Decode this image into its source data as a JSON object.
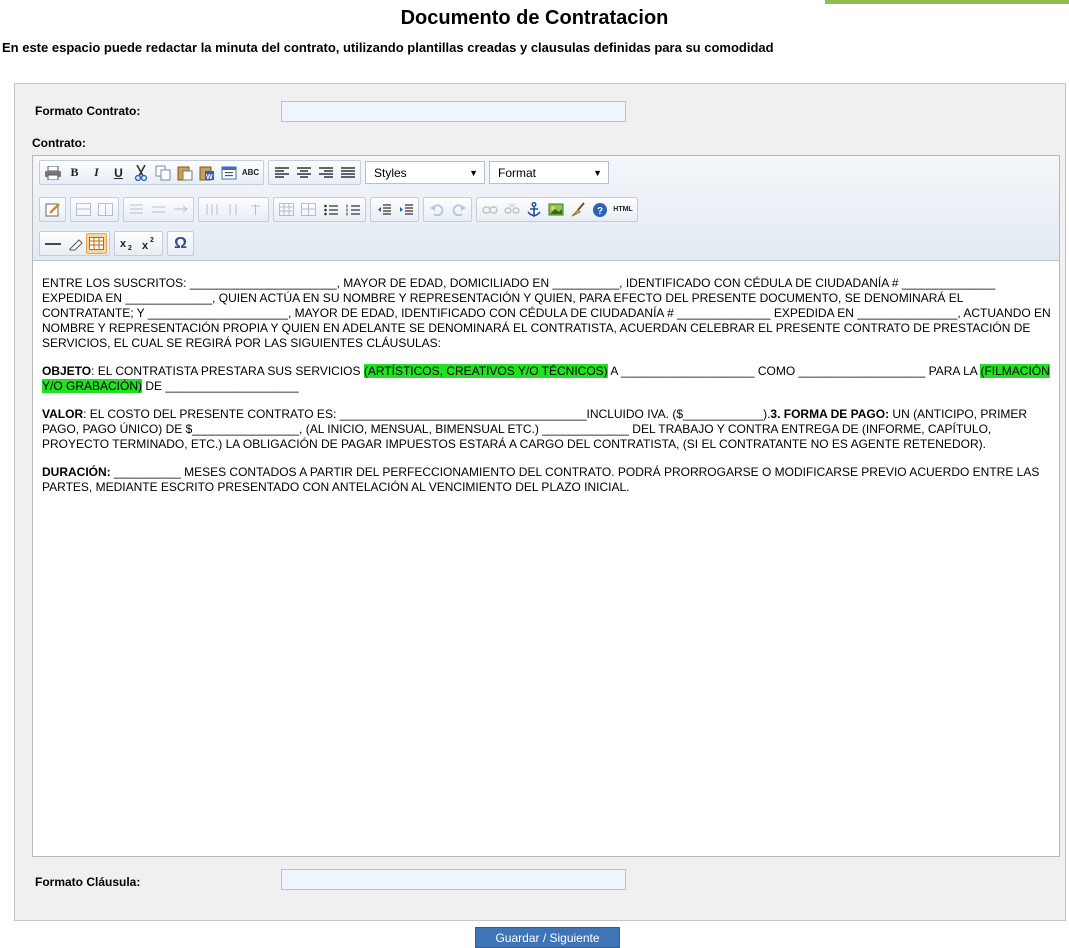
{
  "page": {
    "title": "Documento de Contratacion",
    "subtitle": "En este espacio puede redactar la minuta del contrato, utilizando plantillas creadas y clausulas definidas para su comodidad"
  },
  "form": {
    "formato_contrato_label": "Formato Contrato:",
    "formato_contrato_value": "",
    "contrato_label": "Contrato:",
    "formato_clausula_label": "Formato Cláusula:",
    "formato_clausula_value": ""
  },
  "toolbar": {
    "styles_label": "Styles",
    "format_label": "Format",
    "html_label": "HTML",
    "bold": "B",
    "italic": "I",
    "underline": "U",
    "omega": "Ω"
  },
  "content": {
    "p1": "ENTRE LOS SUSCRITOS: ______________________, MAYOR DE EDAD, DOMICILIADO EN __________, IDENTIFICADO CON CÉDULA DE CIUDADANÍA # ______________ EXPEDIDA EN _____________, QUIEN ACTÚA EN SU NOMBRE Y REPRESENTACIÓN Y QUIEN, PARA EFECTO DEL PRESENTE DOCUMENTO, SE DENOMINARÁ EL CONTRATANTE; Y _____________________, MAYOR DE EDAD, IDENTIFICADO CON CÉDULA DE CIUDADANÍA # ______________ EXPEDIDA EN _______________, ACTUANDO EN NOMBRE Y REPRESENTACIÓN PROPIA Y QUIEN EN ADELANTE SE DENOMINARÁ EL CONTRATISTA, ACUERDAN CELEBRAR EL PRESENTE CONTRATO DE PRESTACIÓN DE SERVICIOS, EL CUAL SE REGIRÁ POR LAS SIGUIENTES CLÁUSULAS:",
    "objeto_label": "OBJETO",
    "objeto_text1": ": EL CONTRATISTA PRESTARA SUS SERVICIOS ",
    "objeto_hl1": "(ARTÍSTICOS, CREATIVOS Y/O TÉCNICOS)",
    "objeto_text2": " A ____________________ COMO ___________________ PARA LA ",
    "objeto_hl2": "(FILMACIÓN Y/O GRABACIÓN)",
    "objeto_text3": " DE ____________________",
    "valor_label": "VALOR",
    "valor_text1": ": EL COSTO DEL PRESENTE CONTRATO ES: _____________________________________INCLUIDO IVA. ($____________).",
    "forma_label": "3. FORMA DE PAGO:",
    "forma_text": " UN (ANTICIPO, PRIMER PAGO, PAGO ÚNICO) DE $________________, (AL INICIO, MENSUAL, BIMENSUAL ETC.) _____________ DEL TRABAJO Y CONTRA ENTREGA DE (INFORME, CAPÍTULO, PROYECTO TERMINADO, ETC.) LA OBLIGACIÓN DE PAGAR IMPUESTOS ESTARÁ A CARGO DEL CONTRATISTA, (SI EL CONTRATANTE NO ES AGENTE RETENEDOR).",
    "duracion_label": "DURACIÓN:",
    "duracion_text": " __________ MESES CONTADOS A PARTIR DEL PERFECCIONAMIENTO DEL CONTRATO. PODRÁ PRORROGARSE O MODIFICARSE PREVIO ACUERDO ENTRE LAS PARTES, MEDIANTE ESCRITO PRESENTADO CON ANTELACIÓN AL VENCIMIENTO DEL PLAZO INICIAL."
  },
  "actions": {
    "save_label": "Guardar / Siguiente"
  }
}
